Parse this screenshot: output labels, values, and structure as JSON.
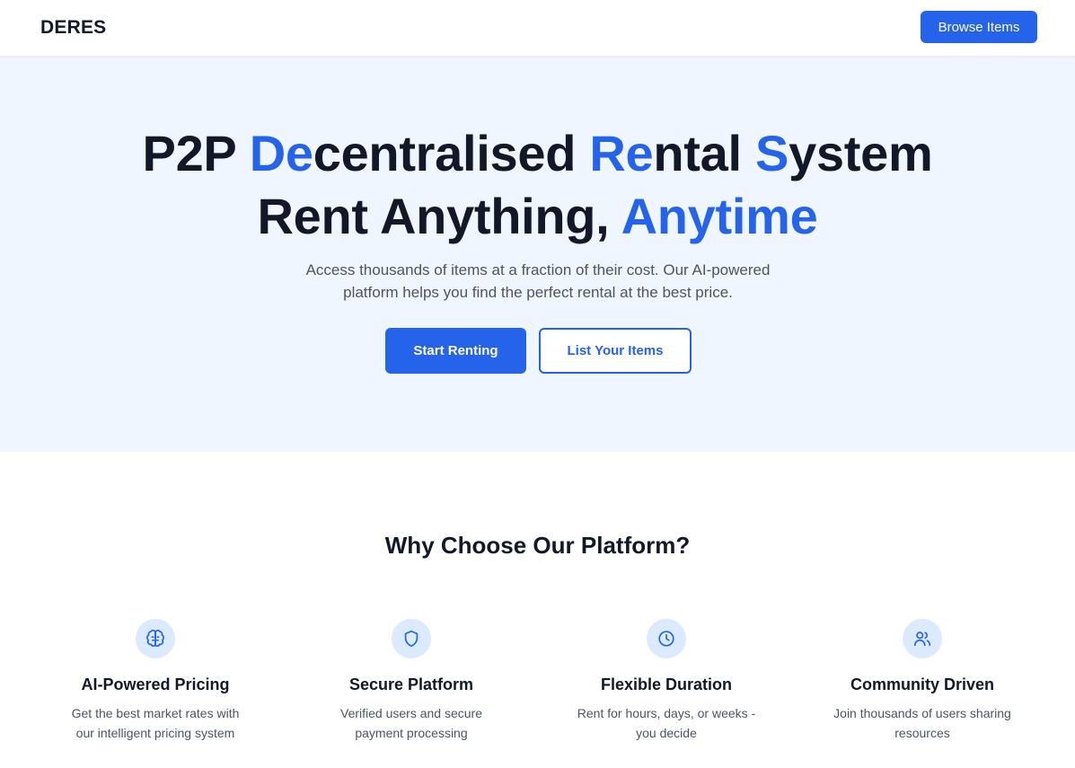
{
  "header": {
    "brand": "DERES",
    "browse_label": "Browse Items"
  },
  "hero": {
    "line1": {
      "p2p": "P2P ",
      "de": "De",
      "centralised": "centralised ",
      "re": "Re",
      "ntal": "ntal ",
      "s": "S",
      "ystem": "ystem"
    },
    "line2": {
      "main": "Rent Anything, ",
      "accent": "Anytime"
    },
    "subtitle": "Access thousands of items at a fraction of their cost. Our AI-powered platform helps you find the perfect rental at the best price.",
    "primary_cta": "Start Renting",
    "secondary_cta": "List Your Items"
  },
  "features": {
    "title": "Why Choose Our Platform?",
    "items": [
      {
        "icon": "brain-icon",
        "title": "AI-Powered Pricing",
        "desc": "Get the best market rates with our intelligent pricing system"
      },
      {
        "icon": "shield-icon",
        "title": "Secure Platform",
        "desc": "Verified users and secure payment processing"
      },
      {
        "icon": "clock-icon",
        "title": "Flexible Duration",
        "desc": "Rent for hours, days, or weeks - you decide"
      },
      {
        "icon": "users-icon",
        "title": "Community Driven",
        "desc": "Join thousands of users sharing resources"
      }
    ]
  },
  "colors": {
    "accent": "#2563eb",
    "hero_bg": "#eff6ff",
    "icon_bg": "#dbeafe"
  }
}
